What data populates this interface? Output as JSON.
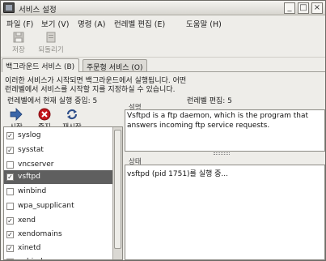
{
  "window": {
    "title": "서비스 설정",
    "controls": {
      "minimize": "_",
      "maximize": "□",
      "close": "×"
    }
  },
  "menubar": {
    "items": [
      "파일 (F)",
      "보기 (V)",
      "명령 (A)",
      "런레벨 편집 (E)",
      "도움말 (H)"
    ]
  },
  "toolbar": {
    "save_label": "저장",
    "revert_label": "되돌리기"
  },
  "tabs": {
    "background": "백그라운드 서비스 (B)",
    "ondemand": "주문형 서비스 (O)"
  },
  "description": {
    "line1": "이러한 서비스가 시작되면 백그라운드에서 실행됩니다. 어떤",
    "line2": "런레벨에서 서비스를 시작할 지를 지정하실 수 있습니다.",
    "current_runlevel": "런레벨에서 현재 실행 중입: 5",
    "edit_runlevel": "런레벨 편집: 5"
  },
  "actions": {
    "start": "시작",
    "stop": "중지",
    "restart": "재시작"
  },
  "services": [
    {
      "name": "syslog",
      "checked": true
    },
    {
      "name": "sysstat",
      "checked": true
    },
    {
      "name": "vncserver",
      "checked": false
    },
    {
      "name": "vsftpd",
      "checked": true,
      "selected": true
    },
    {
      "name": "winbind",
      "checked": false
    },
    {
      "name": "wpa_supplicant",
      "checked": false
    },
    {
      "name": "xend",
      "checked": true
    },
    {
      "name": "xendomains",
      "checked": true
    },
    {
      "name": "xinetd",
      "checked": true
    },
    {
      "name": "ypbind",
      "checked": false
    }
  ],
  "description_pane": {
    "label": "설명",
    "line1": "Vsftpd is a ftp daemon, which is the program that",
    "line2": "answers incoming ftp service requests."
  },
  "status_pane": {
    "label": "상태",
    "text": "vsftpd (pid 1751)를 실행 중..."
  },
  "colors": {
    "window_bg": "#eeede9",
    "selection": "#5f5f5f",
    "start_arrow": "#3a66a8",
    "stop_red": "#c4161c"
  }
}
